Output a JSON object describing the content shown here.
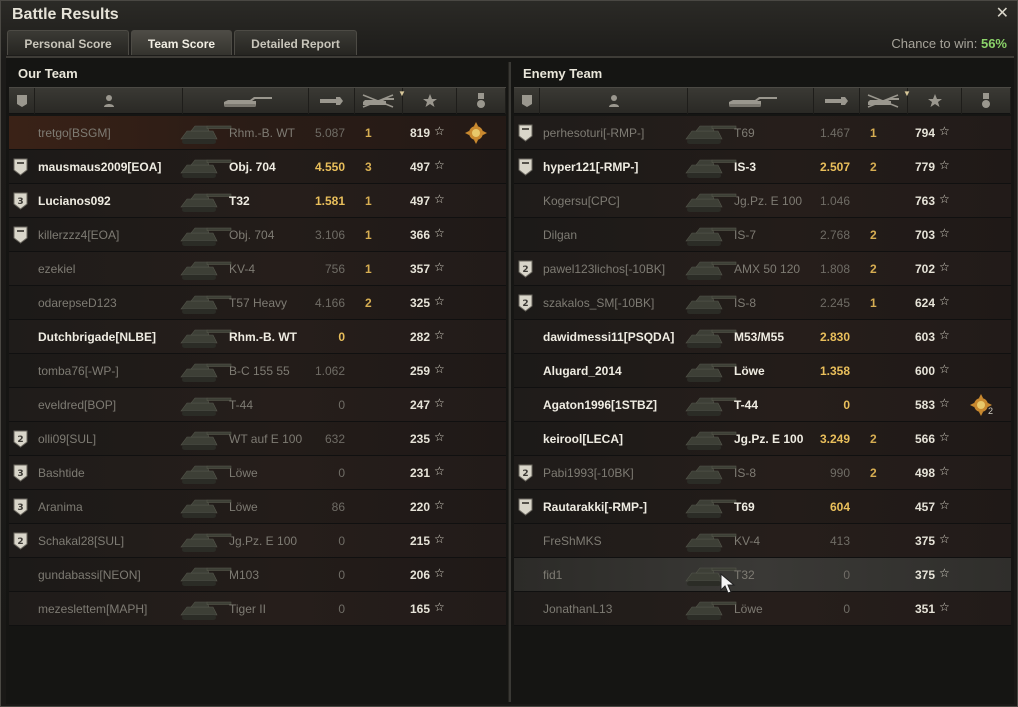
{
  "window": {
    "title": "Battle Results",
    "close_glyph": "✕"
  },
  "tabs": [
    {
      "label": "Personal Score",
      "active": false
    },
    {
      "label": "Team Score",
      "active": true
    },
    {
      "label": "Detailed Report",
      "active": false
    }
  ],
  "chance": {
    "label": "Chance to win:",
    "value": "56%"
  },
  "header_icons": [
    "rank-icon",
    "player-icon",
    "vehicle-icon",
    "damage-icon",
    "kills-icon",
    "score-icon",
    "medal-icon"
  ],
  "our_team": {
    "title": "Our Team",
    "rows": [
      {
        "player": "tretgo[BSGM]",
        "vehicle": "Rhm.-B. WT",
        "damage": "5.087",
        "kills": "1",
        "score": "819",
        "rank": "",
        "bright": false,
        "medal": true,
        "highlight": true
      },
      {
        "player": "mausmaus2009[EOA]",
        "vehicle": "Obj. 704",
        "damage": "4.550",
        "kills": "3",
        "score": "497",
        "rank": "1",
        "bright": true
      },
      {
        "player": "Lucianos092",
        "vehicle": "T32",
        "damage": "1.581",
        "kills": "1",
        "score": "497",
        "rank": "3",
        "bright": true
      },
      {
        "player": "killerzzz4[EOA]",
        "vehicle": "Obj. 704",
        "damage": "3.106",
        "kills": "1",
        "score": "366",
        "rank": "1",
        "bright": false
      },
      {
        "player": "ezekiel",
        "vehicle": "KV-4",
        "damage": "756",
        "kills": "1",
        "score": "357",
        "rank": "",
        "bright": false
      },
      {
        "player": "odarepseD123",
        "vehicle": "T57 Heavy",
        "damage": "4.166",
        "kills": "2",
        "score": "325",
        "rank": "",
        "bright": false
      },
      {
        "player": "Dutchbrigade[NLBE]",
        "vehicle": "Rhm.-B. WT",
        "damage": "0",
        "kills": "",
        "score": "282",
        "rank": "",
        "bright": true
      },
      {
        "player": "tomba76[-WP-]",
        "vehicle": "B-C 155 55",
        "damage": "1.062",
        "kills": "",
        "score": "259",
        "rank": "",
        "bright": false
      },
      {
        "player": "eveldred[BOP]",
        "vehicle": "T-44",
        "damage": "0",
        "kills": "",
        "score": "247",
        "rank": "",
        "bright": false
      },
      {
        "player": "olli09[SUL]",
        "vehicle": "WT auf E 100",
        "damage": "632",
        "kills": "",
        "score": "235",
        "rank": "2",
        "bright": false
      },
      {
        "player": "Bashtide",
        "vehicle": "Löwe",
        "damage": "0",
        "kills": "",
        "score": "231",
        "rank": "3",
        "bright": false
      },
      {
        "player": "Aranima",
        "vehicle": "Löwe",
        "damage": "86",
        "kills": "",
        "score": "220",
        "rank": "3",
        "bright": false
      },
      {
        "player": "Schakal28[SUL]",
        "vehicle": "Jg.Pz. E 100",
        "damage": "0",
        "kills": "",
        "score": "215",
        "rank": "2",
        "bright": false
      },
      {
        "player": "gundabassi[NEON]",
        "vehicle": "M103",
        "damage": "0",
        "kills": "",
        "score": "206",
        "rank": "",
        "bright": false
      },
      {
        "player": "mezeslettem[MAPH]",
        "vehicle": "Tiger II",
        "damage": "0",
        "kills": "",
        "score": "165",
        "rank": "",
        "bright": false
      }
    ]
  },
  "enemy_team": {
    "title": "Enemy Team",
    "rows": [
      {
        "player": "perhesoturi[-RMP-]",
        "vehicle": "T69",
        "damage": "1.467",
        "kills": "1",
        "score": "794",
        "rank": "1",
        "bright": false
      },
      {
        "player": "hyper121[-RMP-]",
        "vehicle": "IS-3",
        "damage": "2.507",
        "kills": "2",
        "score": "779",
        "rank": "1",
        "bright": true
      },
      {
        "player": "Kogersu[CPC]",
        "vehicle": "Jg.Pz. E 100",
        "damage": "1.046",
        "kills": "",
        "score": "763",
        "rank": "",
        "bright": false
      },
      {
        "player": "Dilgan",
        "vehicle": "IS-7",
        "damage": "2.768",
        "kills": "2",
        "score": "703",
        "rank": "",
        "bright": false
      },
      {
        "player": "pawel123lichos[-10BK]",
        "vehicle": "AMX 50 120",
        "damage": "1.808",
        "kills": "2",
        "score": "702",
        "rank": "2",
        "bright": false
      },
      {
        "player": "szakalos_SM[-10BK]",
        "vehicle": "IS-8",
        "damage": "2.245",
        "kills": "1",
        "score": "624",
        "rank": "2",
        "bright": false
      },
      {
        "player": "dawidmessi11[PSQDA]",
        "vehicle": "M53/M55",
        "damage": "2.830",
        "kills": "",
        "score": "603",
        "rank": "",
        "bright": true
      },
      {
        "player": "Alugard_2014",
        "vehicle": "Löwe",
        "damage": "1.358",
        "kills": "",
        "score": "600",
        "rank": "",
        "bright": true
      },
      {
        "player": "Agaton1996[1STBZ]",
        "vehicle": "T-44",
        "damage": "0",
        "kills": "",
        "score": "583",
        "rank": "",
        "bright": true,
        "medal": true,
        "medal_count": "2"
      },
      {
        "player": "keirool[LECA]",
        "vehicle": "Jg.Pz. E 100",
        "damage": "3.249",
        "kills": "2",
        "score": "566",
        "rank": "",
        "bright": true
      },
      {
        "player": "Pabi1993[-10BK]",
        "vehicle": "IS-8",
        "damage": "990",
        "kills": "2",
        "score": "498",
        "rank": "2",
        "bright": false
      },
      {
        "player": "Rautarakki[-RMP-]",
        "vehicle": "T69",
        "damage": "604",
        "kills": "",
        "score": "457",
        "rank": "1",
        "bright": true
      },
      {
        "player": "FreShMKS",
        "vehicle": "KV-4",
        "damage": "413",
        "kills": "",
        "score": "375",
        "rank": "",
        "bright": false
      },
      {
        "player": "fid1",
        "vehicle": "T32",
        "damage": "0",
        "kills": "",
        "score": "375",
        "rank": "",
        "bright": false,
        "hover": true
      },
      {
        "player": "JonathanL13",
        "vehicle": "Löwe",
        "damage": "0",
        "kills": "",
        "score": "351",
        "rank": "",
        "bright": false
      }
    ]
  },
  "colors": {
    "bright_text": "#efece2",
    "dim_text": "#7e7b73",
    "damage_gold": "#e9bf5b",
    "chance_green": "#8bd36a"
  }
}
